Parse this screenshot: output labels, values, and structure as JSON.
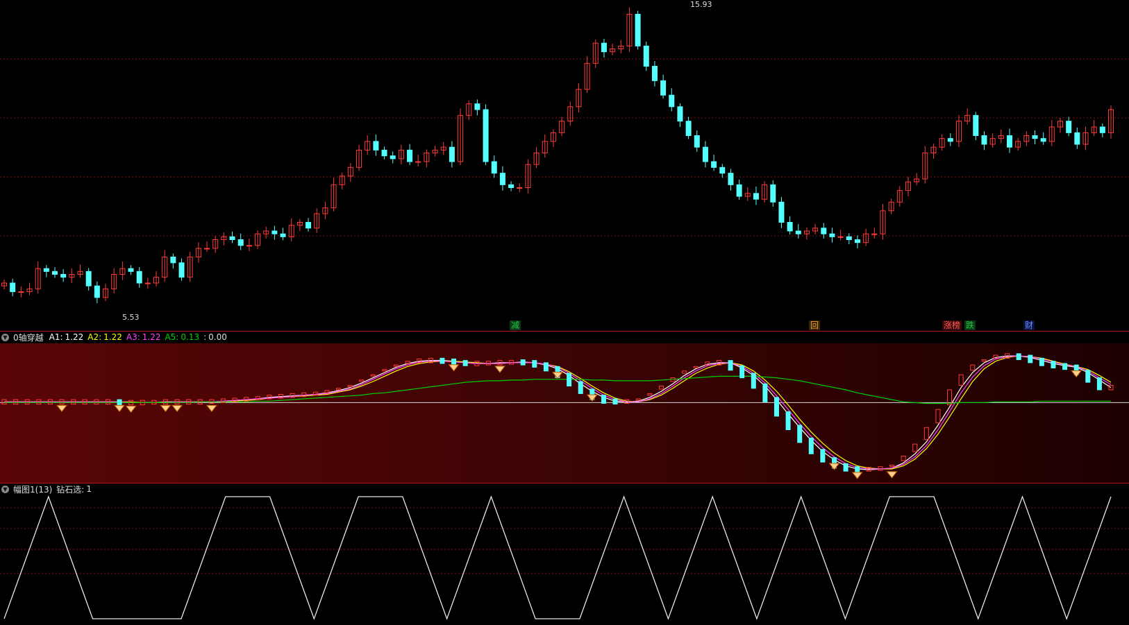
{
  "main": {
    "high_label": "15.93",
    "low_label": "5.53",
    "signals": [
      {
        "text": "减",
        "color": "#27c24c",
        "bg": "#0a3a12",
        "name": "signal-jian"
      },
      {
        "text": "回",
        "color": "#e6a040",
        "bg": "#3a2408",
        "name": "signal-hui"
      },
      {
        "text": "涨榜",
        "color": "#ff5a5a",
        "bg": "#3a0a0a",
        "name": "signal-zhangbang"
      },
      {
        "text": "跌",
        "color": "#27c24c",
        "bg": "#0a3a12",
        "name": "signal-die"
      },
      {
        "text": "财",
        "color": "#6a8cff",
        "bg": "#0a1440",
        "name": "signal-cai"
      }
    ]
  },
  "osc": {
    "title": "0轴穿越",
    "a1_label": "A1:",
    "a1_value": "1.22",
    "a2_label": "A2:",
    "a2_value": "1.22",
    "a3_label": "A3:",
    "a3_value": "1.22",
    "a5_label": "A5:",
    "a5_value": "0.13",
    "extra_label": ":",
    "extra_value": "0.00"
  },
  "bottom": {
    "title": "幅图1(13)",
    "sel_label": "钻石选:",
    "sel_value": "1"
  },
  "colors": {
    "up": "#ff3b3b",
    "down": "#54ffff",
    "grid": "#8a1010",
    "a1": "#ffffff",
    "a2": "#ffff00",
    "a3": "#ff40ff",
    "a5": "#00d000"
  },
  "chart_data": [
    {
      "type": "candlestick",
      "title": "",
      "ylim": [
        5.2,
        16.0
      ],
      "annotations": [
        {
          "text": "15.93",
          "x": 48,
          "y": 15.93
        },
        {
          "text": "5.53",
          "x": 8,
          "y": 5.53
        }
      ],
      "closes": [
        6.4,
        6.1,
        6.1,
        6.2,
        6.9,
        6.8,
        6.7,
        6.6,
        6.7,
        6.8,
        6.3,
        5.9,
        6.2,
        6.7,
        6.9,
        6.8,
        6.4,
        6.4,
        6.6,
        7.3,
        7.1,
        6.6,
        7.3,
        7.6,
        7.6,
        7.9,
        8.0,
        7.9,
        7.7,
        7.7,
        8.1,
        8.2,
        8.1,
        8.0,
        8.4,
        8.5,
        8.3,
        8.8,
        9.0,
        9.8,
        10.1,
        10.4,
        11.0,
        11.3,
        11.0,
        10.8,
        10.7,
        11.0,
        10.6,
        10.6,
        10.9,
        11.0,
        11.1,
        10.6,
        12.2,
        12.6,
        12.4,
        10.6,
        10.2,
        9.8,
        9.7,
        9.7,
        10.5,
        10.9,
        11.3,
        11.6,
        12.0,
        12.5,
        13.1,
        14.0,
        14.7,
        14.4,
        14.5,
        14.6,
        15.7,
        14.6,
        13.9,
        13.4,
        12.9,
        12.5,
        12.0,
        11.5,
        11.1,
        10.6,
        10.4,
        10.2,
        9.8,
        9.4,
        9.5,
        9.3,
        9.8,
        9.2,
        8.5,
        8.2,
        8.1,
        8.2,
        8.3,
        8.1,
        8.0,
        8.0,
        7.9,
        7.8,
        8.1,
        8.1,
        8.9,
        9.2,
        9.6,
        9.9,
        10.0,
        10.9,
        11.1,
        11.4,
        11.3,
        12.0,
        12.2,
        11.5,
        11.2,
        11.4,
        11.5,
        11.1,
        11.3,
        11.5,
        11.4,
        11.3,
        11.8,
        12.0,
        11.6,
        11.2,
        11.6,
        11.8,
        11.6,
        12.4
      ]
    },
    {
      "type": "line",
      "title": "0轴穿越",
      "series": [
        {
          "name": "A1",
          "values": [
            1.21,
            1.21,
            1.21,
            1.21,
            1.21,
            1.21,
            1.21,
            1.21,
            1.21,
            1.21,
            1.21,
            1.2,
            1.2,
            1.2,
            1.21,
            1.21,
            1.21,
            1.21,
            1.21,
            1.22,
            1.23,
            1.24,
            1.25,
            1.27,
            1.28,
            1.29,
            1.3,
            1.31,
            1.33,
            1.36,
            1.4,
            1.46,
            1.53,
            1.6,
            1.67,
            1.72,
            1.75,
            1.76,
            1.76,
            1.75,
            1.73,
            1.72,
            1.72,
            1.73,
            1.73,
            1.74,
            1.73,
            1.7,
            1.65,
            1.56,
            1.45,
            1.35,
            1.27,
            1.22,
            1.21,
            1.22,
            1.27,
            1.35,
            1.45,
            1.56,
            1.65,
            1.71,
            1.73,
            1.73,
            1.66,
            1.56,
            1.42,
            1.24,
            1.05,
            0.87,
            0.7,
            0.55,
            0.44,
            0.36,
            0.32,
            0.31,
            0.32,
            0.33,
            0.4,
            0.52,
            0.68,
            0.9,
            1.14,
            1.4,
            1.6,
            1.73,
            1.8,
            1.82,
            1.82,
            1.8,
            1.76,
            1.72,
            1.69,
            1.67,
            1.6,
            1.5,
            1.4
          ]
        },
        {
          "name": "A2",
          "values": [
            1.21,
            1.21,
            1.21,
            1.21,
            1.21,
            1.21,
            1.21,
            1.21,
            1.21,
            1.21,
            1.21,
            1.21,
            1.2,
            1.2,
            1.2,
            1.21,
            1.21,
            1.21,
            1.21,
            1.21,
            1.22,
            1.23,
            1.24,
            1.26,
            1.27,
            1.28,
            1.29,
            1.3,
            1.31,
            1.34,
            1.37,
            1.42,
            1.48,
            1.55,
            1.62,
            1.68,
            1.72,
            1.74,
            1.75,
            1.75,
            1.74,
            1.73,
            1.72,
            1.72,
            1.73,
            1.73,
            1.73,
            1.71,
            1.68,
            1.61,
            1.52,
            1.42,
            1.33,
            1.26,
            1.22,
            1.21,
            1.24,
            1.3,
            1.39,
            1.49,
            1.59,
            1.66,
            1.71,
            1.73,
            1.7,
            1.62,
            1.5,
            1.35,
            1.17,
            0.98,
            0.81,
            0.66,
            0.53,
            0.43,
            0.36,
            0.33,
            0.32,
            0.32,
            0.36,
            0.45,
            0.59,
            0.78,
            1.01,
            1.25,
            1.48,
            1.65,
            1.75,
            1.8,
            1.82,
            1.81,
            1.79,
            1.75,
            1.71,
            1.68,
            1.64,
            1.56,
            1.47
          ]
        },
        {
          "name": "A3",
          "values": [
            1.21,
            1.21,
            1.21,
            1.21,
            1.21,
            1.21,
            1.21,
            1.21,
            1.21,
            1.21,
            1.21,
            1.2,
            1.2,
            1.2,
            1.2,
            1.21,
            1.21,
            1.21,
            1.21,
            1.22,
            1.23,
            1.24,
            1.25,
            1.26,
            1.27,
            1.28,
            1.3,
            1.31,
            1.32,
            1.35,
            1.38,
            1.44,
            1.51,
            1.58,
            1.65,
            1.7,
            1.74,
            1.75,
            1.75,
            1.74,
            1.73,
            1.72,
            1.72,
            1.72,
            1.73,
            1.73,
            1.73,
            1.71,
            1.67,
            1.59,
            1.49,
            1.39,
            1.3,
            1.24,
            1.21,
            1.21,
            1.25,
            1.32,
            1.42,
            1.53,
            1.62,
            1.69,
            1.72,
            1.73,
            1.68,
            1.59,
            1.46,
            1.29,
            1.11,
            0.92,
            0.75,
            0.6,
            0.48,
            0.39,
            0.34,
            0.32,
            0.32,
            0.33,
            0.38,
            0.48,
            0.63,
            0.84,
            1.08,
            1.33,
            1.54,
            1.69,
            1.78,
            1.81,
            1.82,
            1.81,
            1.78,
            1.74,
            1.7,
            1.68,
            1.62,
            1.53,
            1.44
          ]
        },
        {
          "name": "A5",
          "values": [
            1.2,
            1.2,
            1.2,
            1.2,
            1.2,
            1.2,
            1.2,
            1.2,
            1.2,
            1.2,
            1.2,
            1.2,
            1.2,
            1.2,
            1.2,
            1.2,
            1.2,
            1.21,
            1.21,
            1.21,
            1.21,
            1.21,
            1.22,
            1.22,
            1.23,
            1.24,
            1.25,
            1.26,
            1.27,
            1.28,
            1.29,
            1.3,
            1.32,
            1.33,
            1.35,
            1.37,
            1.39,
            1.41,
            1.43,
            1.45,
            1.47,
            1.48,
            1.49,
            1.49,
            1.5,
            1.5,
            1.51,
            1.51,
            1.51,
            1.51,
            1.51,
            1.5,
            1.5,
            1.49,
            1.49,
            1.49,
            1.49,
            1.5,
            1.51,
            1.52,
            1.53,
            1.54,
            1.55,
            1.55,
            1.55,
            1.55,
            1.54,
            1.53,
            1.51,
            1.49,
            1.46,
            1.43,
            1.4,
            1.37,
            1.33,
            1.3,
            1.27,
            1.24,
            1.21,
            1.2,
            1.19,
            1.19,
            1.19,
            1.2,
            1.2,
            1.2,
            1.21,
            1.21,
            1.21,
            1.21,
            1.22,
            1.22,
            1.22,
            1.22,
            1.22,
            1.22,
            1.22
          ]
        }
      ],
      "markers_x": [
        13,
        25,
        26,
        35,
        37,
        44,
        94,
        104,
        117,
        123,
        175,
        178,
        186,
        225
      ]
    },
    {
      "type": "line",
      "title": "幅图1(13) 钻石选",
      "series": [
        {
          "name": "钻石选",
          "values": [
            0,
            1,
            0,
            0,
            0,
            1,
            1,
            0,
            1,
            1,
            0,
            1,
            0,
            0,
            1,
            0,
            1,
            0,
            1,
            0,
            1,
            1,
            0,
            1,
            0,
            1
          ]
        }
      ]
    }
  ]
}
